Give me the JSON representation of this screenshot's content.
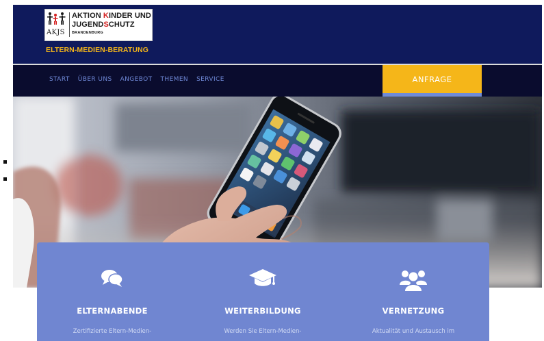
{
  "header": {
    "logo": {
      "abbr": "AKJS",
      "line1_a": "AKTION ",
      "line1_b": "K",
      "line1_c": "INDER UND",
      "line2_a": "JUGEND",
      "line2_b": "S",
      "line2_c": "CHUTZ",
      "line3": "BRANDENBURG"
    },
    "tagline": "ELTERN-MEDIEN-BERATUNG",
    "background_color": "#0f1a5c",
    "accent_color": "#f5b619"
  },
  "nav": {
    "items": [
      {
        "label": "START"
      },
      {
        "label": "ÜBER UNS"
      },
      {
        "label": "ANGEBOT"
      },
      {
        "label": "THEMEN"
      },
      {
        "label": "SERVICE"
      }
    ],
    "cta_label": "ANFRAGE",
    "cta_color": "#f5b619",
    "background_color": "#0a0c2e"
  },
  "hero": {
    "image_icon": "hand-holding-smartphone-photo"
  },
  "features": [
    {
      "icon": "chat-bubbles-icon",
      "title": "ELTERNABENDE",
      "description": "Zertifizierte Eltern-Medien-"
    },
    {
      "icon": "graduation-cap-icon",
      "title": "WEITERBILDUNG",
      "description": "Werden Sie Eltern-Medien-"
    },
    {
      "icon": "users-group-icon",
      "title": "VERNETZUNG",
      "description": "Aktualität und Austausch im"
    }
  ],
  "card_color": "#7086d1"
}
